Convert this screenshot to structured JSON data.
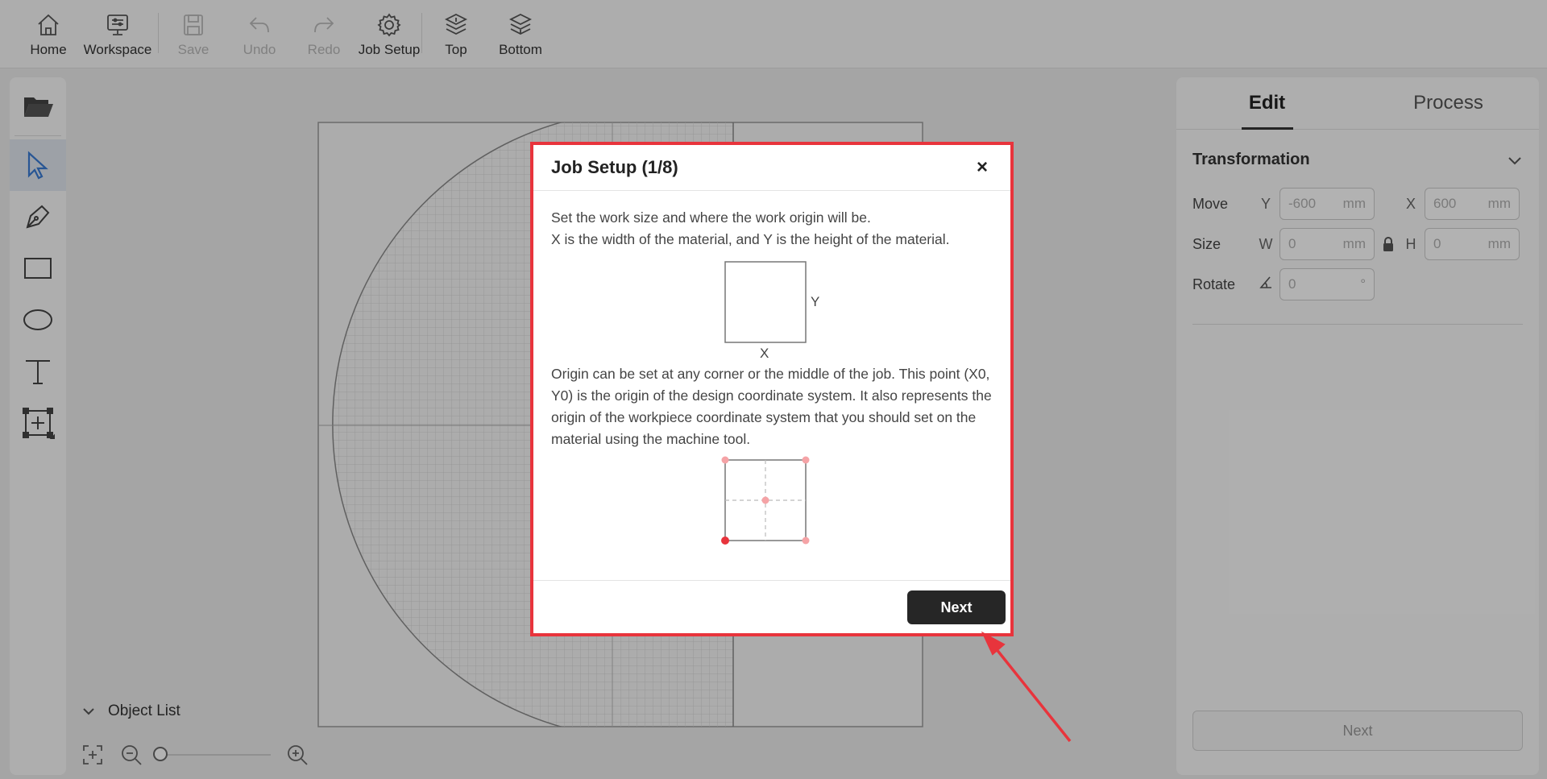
{
  "toolbar": {
    "items": [
      {
        "label": "Home",
        "icon": "home-icon",
        "enabled": true
      },
      {
        "label": "Workspace",
        "icon": "workspace-icon",
        "enabled": true
      },
      {
        "label": "Save",
        "icon": "save-icon",
        "enabled": false
      },
      {
        "label": "Undo",
        "icon": "undo-icon",
        "enabled": false
      },
      {
        "label": "Redo",
        "icon": "redo-icon",
        "enabled": false
      },
      {
        "label": "Job Setup",
        "icon": "gear-icon",
        "enabled": true
      },
      {
        "label": "Top",
        "icon": "layers-top-icon",
        "enabled": true
      },
      {
        "label": "Bottom",
        "icon": "layers-bottom-icon",
        "enabled": true
      }
    ]
  },
  "left_tools": [
    "folder-open-icon",
    "select-arrow-icon",
    "pen-icon",
    "rectangle-icon",
    "ellipse-icon",
    "text-icon",
    "add-frame-icon"
  ],
  "object_list": {
    "label": "Object List"
  },
  "right_panel": {
    "tabs": [
      "Edit",
      "Process"
    ],
    "active_tab": "Edit",
    "section_title": "Transformation",
    "move": {
      "label": "Move",
      "y_axis": "Y",
      "y_value": "-600",
      "y_unit": "mm",
      "x_axis": "X",
      "x_value": "600",
      "x_unit": "mm"
    },
    "size": {
      "label": "Size",
      "w_axis": "W",
      "w_value": "0",
      "w_unit": "mm",
      "h_axis": "H",
      "h_value": "0",
      "h_unit": "mm"
    },
    "rotate": {
      "label": "Rotate",
      "value": "0",
      "unit": "°"
    },
    "next_label": "Next"
  },
  "dialog": {
    "title": "Job Setup (1/8)",
    "close": "×",
    "para1_line1": "Set the work size and where the work origin will be.",
    "para1_line2": "X is the width of the material, and Y is the height of the material.",
    "fig_x_label": "X",
    "fig_y_label": "Y",
    "para2": "Origin can be set at any corner or the middle of the job. This point (X0, Y0) is the origin of the design coordinate system. It also represents the origin of the workpiece coordinate system that you should set on the material using the machine tool.",
    "next_label": "Next"
  },
  "colors": {
    "accent": "#e8343c",
    "select_blue": "#3a7bd5",
    "dark_button": "#262626"
  }
}
